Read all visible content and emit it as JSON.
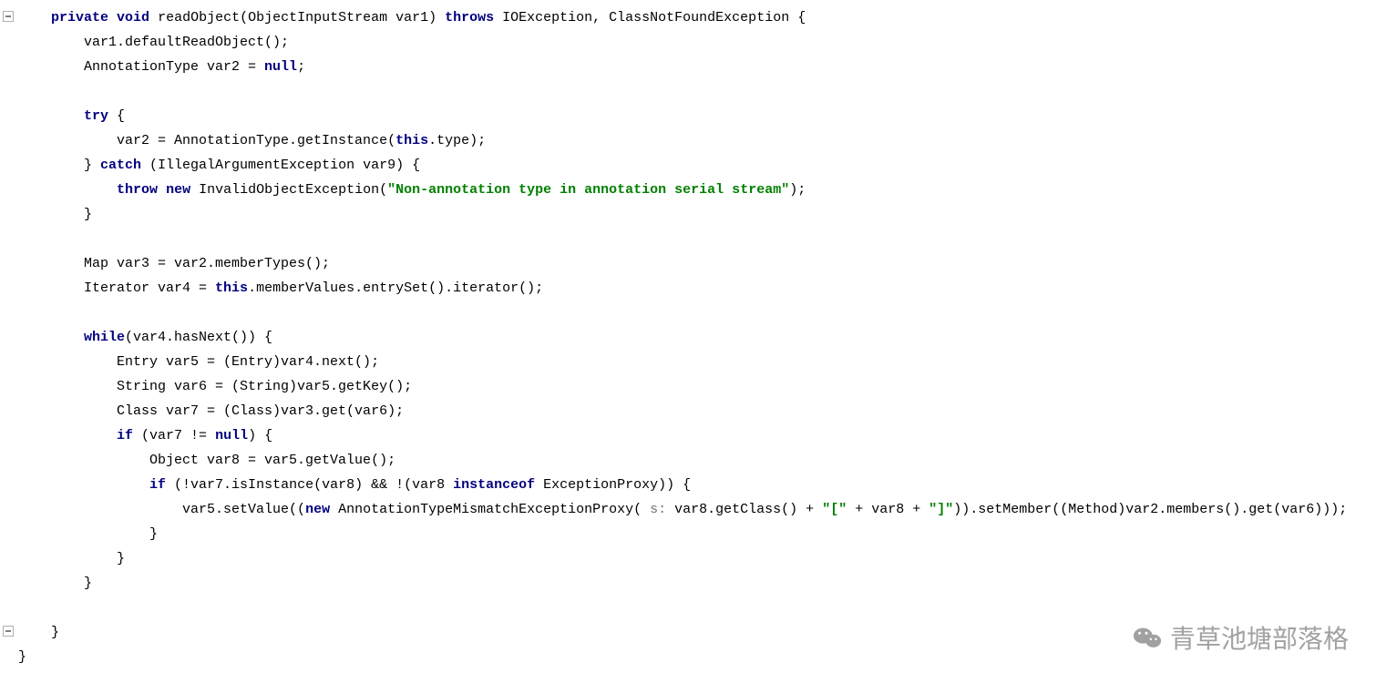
{
  "watermark": {
    "text": "青草池塘部落格"
  },
  "code": {
    "lines": [
      {
        "i": 1,
        "segs": [
          {
            "t": "    "
          },
          {
            "t": "private",
            "c": "kw"
          },
          {
            "t": " "
          },
          {
            "t": "void",
            "c": "kw"
          },
          {
            "t": " readObject(ObjectInputStream var1) "
          },
          {
            "t": "throws",
            "c": "kw"
          },
          {
            "t": " IOException, ClassNotFoundException {"
          }
        ]
      },
      {
        "i": 2,
        "segs": [
          {
            "t": "        var1.defaultReadObject();"
          }
        ]
      },
      {
        "i": 3,
        "segs": [
          {
            "t": "        AnnotationType var2 = "
          },
          {
            "t": "null",
            "c": "kw"
          },
          {
            "t": ";"
          }
        ]
      },
      {
        "i": 4,
        "segs": [
          {
            "t": ""
          }
        ]
      },
      {
        "i": 5,
        "segs": [
          {
            "t": "        "
          },
          {
            "t": "try",
            "c": "kw"
          },
          {
            "t": " {"
          }
        ]
      },
      {
        "i": 6,
        "segs": [
          {
            "t": "            var2 = AnnotationType.getInstance("
          },
          {
            "t": "this",
            "c": "kw"
          },
          {
            "t": ".type);"
          }
        ]
      },
      {
        "i": 7,
        "segs": [
          {
            "t": "        } "
          },
          {
            "t": "catch",
            "c": "kw"
          },
          {
            "t": " (IllegalArgumentException var9) {"
          }
        ]
      },
      {
        "i": 8,
        "segs": [
          {
            "t": "            "
          },
          {
            "t": "throw",
            "c": "kw"
          },
          {
            "t": " "
          },
          {
            "t": "new",
            "c": "kw"
          },
          {
            "t": " InvalidObjectException("
          },
          {
            "t": "\"Non-annotation type in annotation serial stream\"",
            "c": "str"
          },
          {
            "t": ");"
          }
        ]
      },
      {
        "i": 9,
        "segs": [
          {
            "t": "        }"
          }
        ]
      },
      {
        "i": 10,
        "segs": [
          {
            "t": ""
          }
        ]
      },
      {
        "i": 11,
        "segs": [
          {
            "t": "        Map var3 = var2.memberTypes();"
          }
        ]
      },
      {
        "i": 12,
        "segs": [
          {
            "t": "        Iterator var4 = "
          },
          {
            "t": "this",
            "c": "kw"
          },
          {
            "t": ".memberValues.entrySet().iterator();"
          }
        ]
      },
      {
        "i": 13,
        "segs": [
          {
            "t": ""
          }
        ]
      },
      {
        "i": 14,
        "segs": [
          {
            "t": "        "
          },
          {
            "t": "while",
            "c": "kw"
          },
          {
            "t": "(var4.hasNext()) {"
          }
        ]
      },
      {
        "i": 15,
        "segs": [
          {
            "t": "            Entry var5 = (Entry)var4.next();"
          }
        ]
      },
      {
        "i": 16,
        "segs": [
          {
            "t": "            String var6 = (String)var5.getKey();"
          }
        ]
      },
      {
        "i": 17,
        "segs": [
          {
            "t": "            Class var7 = (Class)var3.get(var6);"
          }
        ]
      },
      {
        "i": 18,
        "segs": [
          {
            "t": "            "
          },
          {
            "t": "if",
            "c": "kw"
          },
          {
            "t": " (var7 != "
          },
          {
            "t": "null",
            "c": "kw"
          },
          {
            "t": ") {"
          }
        ]
      },
      {
        "i": 19,
        "segs": [
          {
            "t": "                Object var8 = var5.getValue();"
          }
        ]
      },
      {
        "i": 20,
        "segs": [
          {
            "t": "                "
          },
          {
            "t": "if",
            "c": "kw"
          },
          {
            "t": " (!var7.isInstance(var8) && !(var8 "
          },
          {
            "t": "instanceof",
            "c": "kw"
          },
          {
            "t": " ExceptionProxy)) {"
          }
        ]
      },
      {
        "i": 21,
        "segs": [
          {
            "t": "                    var5.setValue(("
          },
          {
            "t": "new",
            "c": "kw"
          },
          {
            "t": " AnnotationTypeMismatchExceptionProxy( "
          },
          {
            "t": "s:",
            "c": "hint"
          },
          {
            "t": " var8.getClass() + "
          },
          {
            "t": "\"[\"",
            "c": "str"
          },
          {
            "t": " + var8 + "
          },
          {
            "t": "\"]\"",
            "c": "str"
          },
          {
            "t": ")).setMember((Method)var2.members().get(var6)));"
          }
        ]
      },
      {
        "i": 22,
        "segs": [
          {
            "t": "                }"
          }
        ]
      },
      {
        "i": 23,
        "segs": [
          {
            "t": "            }"
          }
        ]
      },
      {
        "i": 24,
        "segs": [
          {
            "t": "        }"
          }
        ]
      },
      {
        "i": 25,
        "segs": [
          {
            "t": ""
          }
        ]
      },
      {
        "i": 26,
        "segs": [
          {
            "t": "    }"
          }
        ]
      },
      {
        "i": 27,
        "segs": [
          {
            "t": "}"
          }
        ]
      }
    ]
  }
}
